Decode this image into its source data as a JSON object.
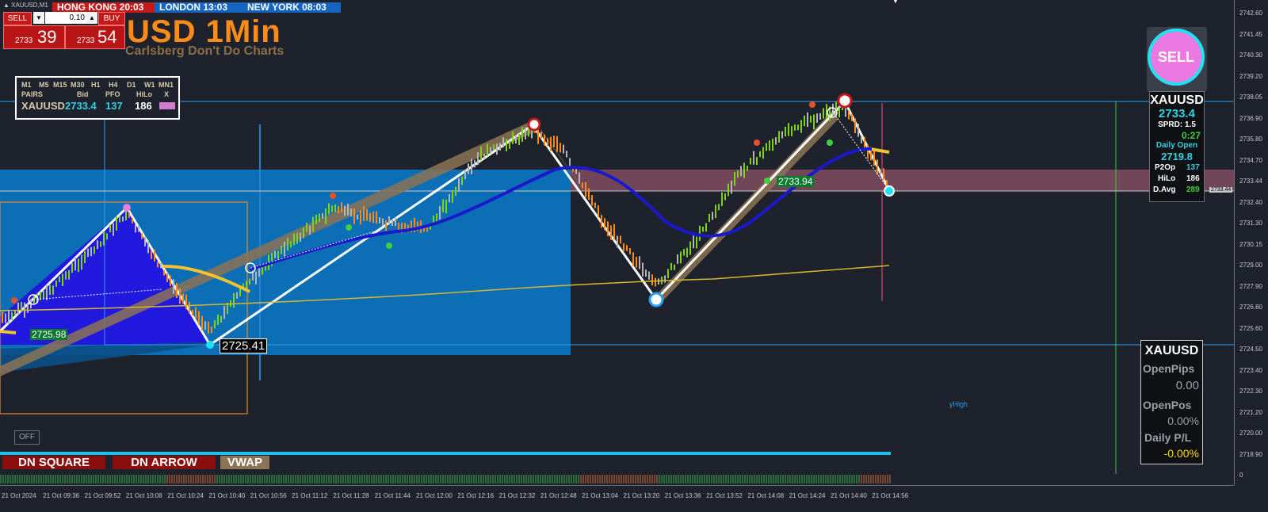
{
  "window": {
    "title": "XAUUSD,M1"
  },
  "clocks": [
    {
      "label": "HONG KONG 20:03",
      "bg": "#c41a1a"
    },
    {
      "label": "LONDON  13:03",
      "bg": "#1565c0"
    },
    {
      "label": "NEW YORK  08:03",
      "bg": "#1565c0"
    }
  ],
  "trade": {
    "sell_label": "SELL",
    "buy_label": "BUY",
    "lot": "0.10",
    "bid_small": "2733",
    "bid_big": "39",
    "ask_small": "2733",
    "ask_big": "54"
  },
  "header": {
    "title": "USD 1Min",
    "subtitle": "Carlsberg Don't Do Charts"
  },
  "timeframes": {
    "row1": [
      "M1",
      "M5",
      "M15",
      "M30",
      "H1",
      "H4",
      "D1",
      "W1",
      "MN1"
    ],
    "row2": [
      "PAIRS",
      "Bid",
      "PFO",
      "HiLo",
      "X"
    ],
    "row3": {
      "pair": "XAUUSD",
      "bid": "2733.4",
      "pfo": "137",
      "hilo": "186"
    },
    "x_color": "#d37bd0"
  },
  "signal": {
    "label": "SELL"
  },
  "info": {
    "pair": "XAUUSD",
    "price": "2733.4",
    "spread": "SPRD: 1.5",
    "timer": "0:27",
    "daily_open_label": "Daily Open",
    "daily_open": "2719.8",
    "p2op_label": "P2Op",
    "p2op": "137",
    "hilo_label": "HiLo",
    "hilo": "186",
    "davg_label": "D.Avg",
    "davg": "289"
  },
  "pips_panel": {
    "pair": "XAUUSD",
    "open_pips_label": "OpenPips",
    "open_pips": "0.00",
    "open_pos_label": "OpenPos",
    "open_pos": "0.00%",
    "daily_pl_label": "Daily P/L",
    "daily_pl": "-0.00%"
  },
  "labels": {
    "low1": "2725.98",
    "low2": "2725.41",
    "mid": "2733.94",
    "yhigh": "yHigh",
    "current_price": "2733.44"
  },
  "buttons": {
    "off": "OFF",
    "dn_square": "DN SQUARE",
    "dn_arrow": "DN ARROW",
    "vwap": "VWAP"
  },
  "price_axis": [
    "2742.60",
    "2741.45",
    "2740.30",
    "2739.20",
    "2738.05",
    "2736.90",
    "2735.80",
    "2734.70",
    "2733.44",
    "2732.40",
    "2731.30",
    "2730.15",
    "2729.00",
    "2727.90",
    "2726.80",
    "2725.60",
    "2724.50",
    "2723.40",
    "2722.30",
    "2721.20",
    "2720.00",
    "2718.90",
    "0"
  ],
  "time_axis": [
    "21 Oct 2024",
    "21 Oct 09:36",
    "21 Oct 09:52",
    "21 Oct 10:08",
    "21 Oct 10:24",
    "21 Oct 10:40",
    "21 Oct 10:56",
    "21 Oct 11:12",
    "21 Oct 11:28",
    "21 Oct 11:44",
    "21 Oct 12:00",
    "21 Oct 12:16",
    "21 Oct 12:32",
    "21 Oct 12:48",
    "21 Oct 13:04",
    "21 Oct 13:20",
    "21 Oct 13:36",
    "21 Oct 13:52",
    "21 Oct 14:08",
    "21 Oct 14:24",
    "21 Oct 14:40",
    "21 Oct 14:56"
  ],
  "colors": {
    "bg": "#1e222d",
    "bull": "#7ed321",
    "bear": "#ff8c1a",
    "neutral": "#b5b5b5",
    "ma": "#1a1acc",
    "vwap": "#d4b832",
    "zone_blue": "#0c6fb5",
    "zone_pink": "#8a4c62"
  }
}
